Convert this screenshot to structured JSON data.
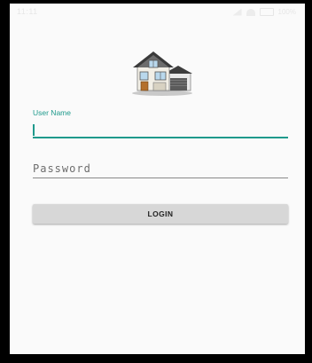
{
  "status_bar": {
    "time": "11:11",
    "battery": "100%"
  },
  "logo": {
    "icon": "house-icon"
  },
  "form": {
    "username_label": "User Name",
    "username_value": "",
    "password_placeholder": "Password",
    "login_label": "LOGIN"
  },
  "colors": {
    "accent": "#1f9a8c",
    "button_bg": "#d7d7d7",
    "screen_bg": "#fafafa"
  }
}
